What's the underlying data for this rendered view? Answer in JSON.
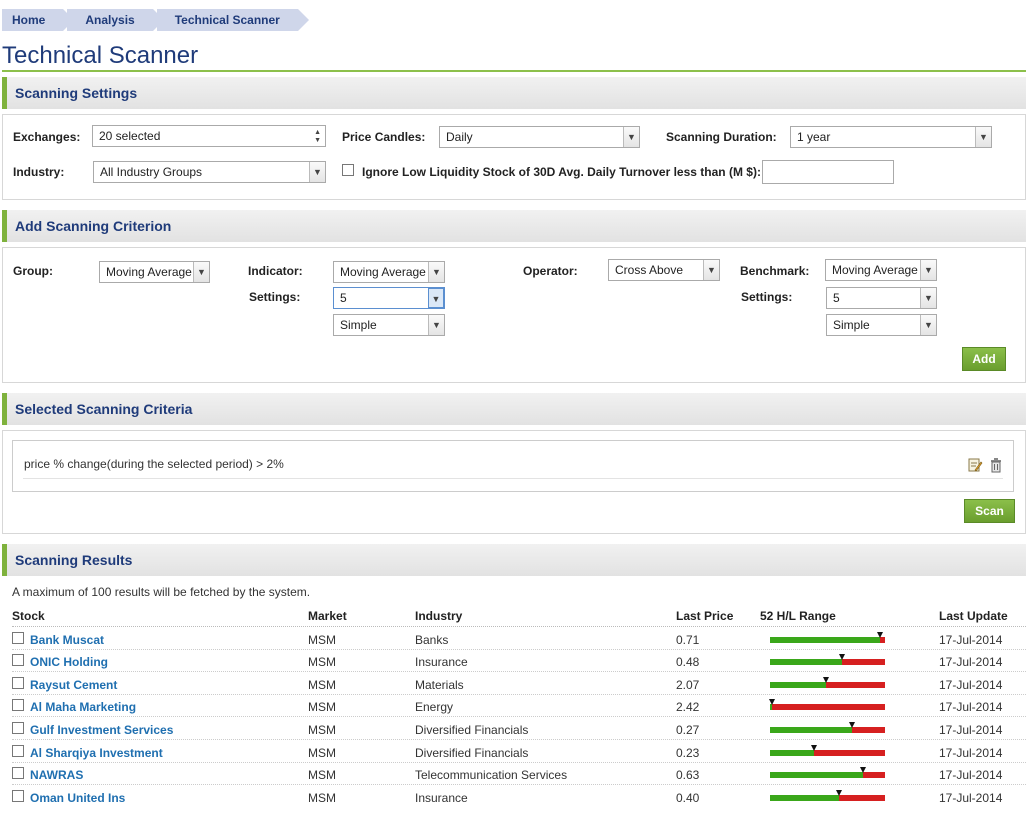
{
  "breadcrumb": [
    "Home",
    "Analysis",
    "Technical Scanner"
  ],
  "page_title": "Technical Scanner",
  "settings": {
    "header": "Scanning Settings",
    "exchanges_label": "Exchanges:",
    "exchanges_value": "20 selected",
    "price_candles_label": "Price Candles:",
    "price_candles_value": "Daily",
    "duration_label": "Scanning Duration:",
    "duration_value": "1 year",
    "industry_label": "Industry:",
    "industry_value": "All Industry Groups",
    "liquidity_label": "Ignore Low Liquidity Stock of 30D Avg. Daily Turnover less than (M $):",
    "liquidity_value": ""
  },
  "criterion": {
    "header": "Add Scanning Criterion",
    "group_label": "Group:",
    "group_value": "Moving Average",
    "indicator_label": "Indicator:",
    "indicator_value": "Moving Average",
    "settings_label": "Settings:",
    "indicator_setting1": "5",
    "indicator_setting2": "Simple",
    "operator_label": "Operator:",
    "operator_value": "Cross Above",
    "benchmark_label": "Benchmark:",
    "benchmark_value": "Moving Average",
    "benchmark_settings_label": "Settings:",
    "benchmark_setting1": "5",
    "benchmark_setting2": "Simple",
    "add_label": "Add"
  },
  "selected": {
    "header": "Selected Scanning Criteria",
    "items": [
      "price % change(during the selected period) > 2%"
    ],
    "scan_label": "Scan"
  },
  "results": {
    "header": "Scanning Results",
    "note": "A maximum of 100 results will be fetched by the system.",
    "columns": [
      "Stock",
      "Market",
      "Industry",
      "Last Price",
      "52 H/L Range",
      "Last Update"
    ],
    "rows": [
      {
        "stock": "Bank Muscat",
        "market": "MSM",
        "industry": "Banks",
        "price": "0.71",
        "range": 0.96,
        "update": "17-Jul-2014"
      },
      {
        "stock": "ONIC Holding",
        "market": "MSM",
        "industry": "Insurance",
        "price": "0.48",
        "range": 0.63,
        "update": "17-Jul-2014"
      },
      {
        "stock": "Raysut Cement",
        "market": "MSM",
        "industry": "Materials",
        "price": "2.07",
        "range": 0.49,
        "update": "17-Jul-2014"
      },
      {
        "stock": "Al Maha Marketing",
        "market": "MSM",
        "industry": "Energy",
        "price": "2.42",
        "range": 0.02,
        "update": "17-Jul-2014"
      },
      {
        "stock": "Gulf Investment Services",
        "market": "MSM",
        "industry": "Diversified Financials",
        "price": "0.27",
        "range": 0.71,
        "update": "17-Jul-2014"
      },
      {
        "stock": "Al Sharqiya Investment",
        "market": "MSM",
        "industry": "Diversified Financials",
        "price": "0.23",
        "range": 0.38,
        "update": "17-Jul-2014"
      },
      {
        "stock": "NAWRAS",
        "market": "MSM",
        "industry": "Telecommunication Services",
        "price": "0.63",
        "range": 0.81,
        "update": "17-Jul-2014"
      },
      {
        "stock": "Oman United Ins",
        "market": "MSM",
        "industry": "Insurance",
        "price": "0.40",
        "range": 0.6,
        "update": "17-Jul-2014"
      }
    ]
  },
  "colors": {
    "accent_green": "#7fb23d",
    "title_blue": "#1f3b7a",
    "link_blue": "#1f6fb0",
    "range_green": "#3aa71a",
    "range_red": "#d62020"
  }
}
